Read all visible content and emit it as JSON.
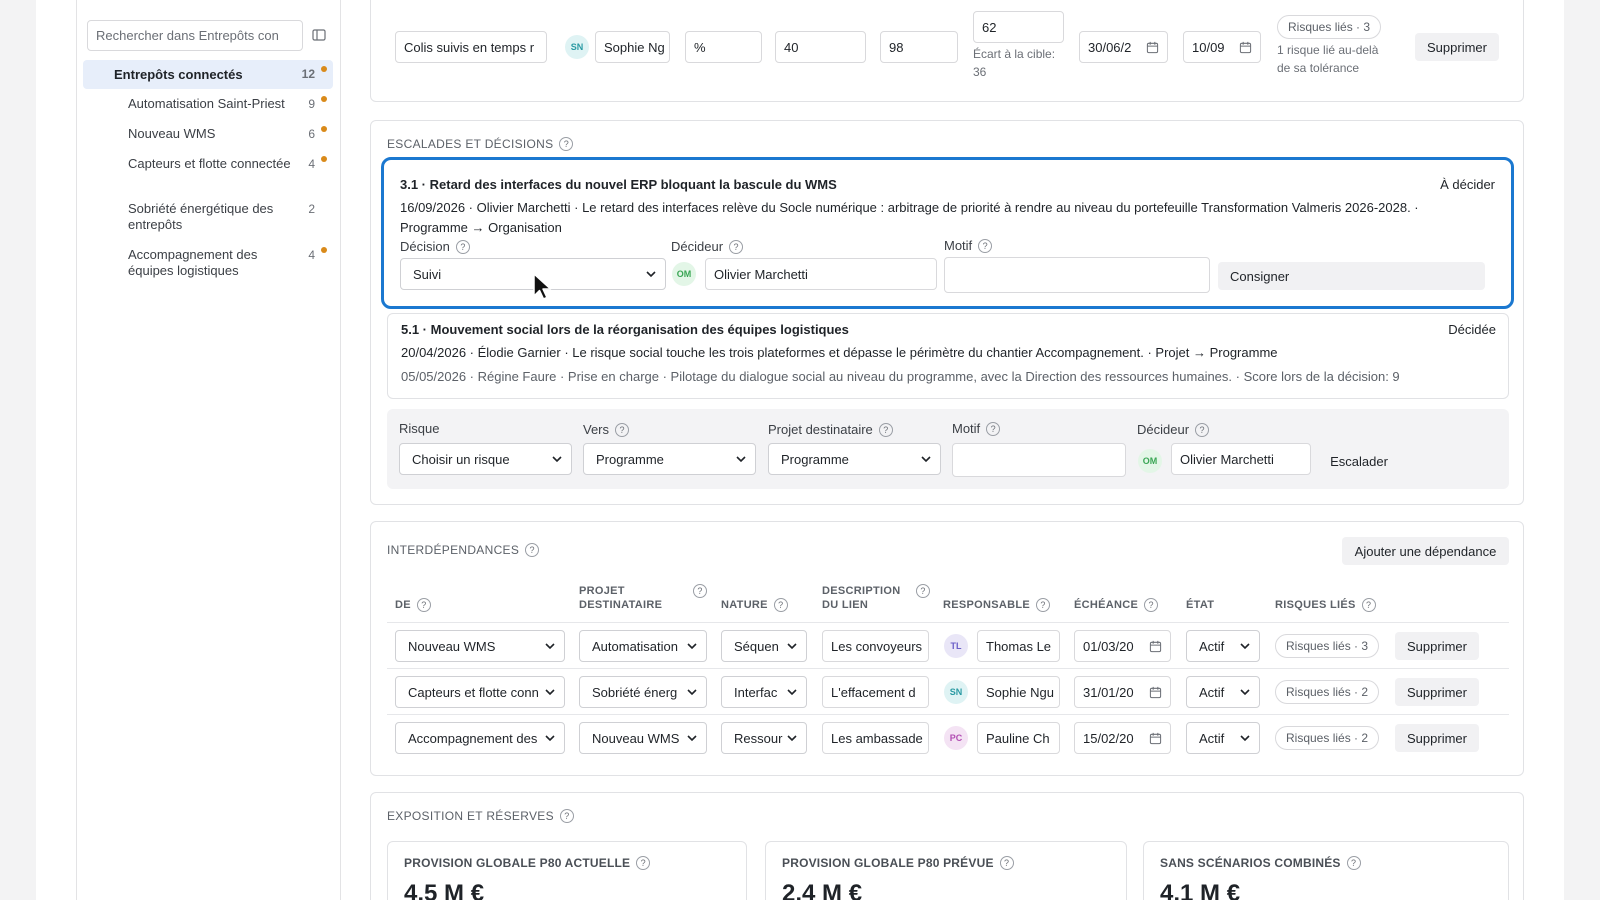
{
  "sidebar": {
    "search_placeholder": "Rechercher dans Entrepôts con",
    "root": {
      "label": "Entrepôts connectés",
      "count": "12"
    },
    "items": [
      {
        "label": "Automatisation Saint-Priest",
        "count": "9",
        "dot": true
      },
      {
        "label": "Nouveau WMS",
        "count": "6",
        "dot": true
      },
      {
        "label": "Capteurs et flotte connectée",
        "count": "4",
        "dot": true
      },
      {
        "label": "Sobriété énergétique des entrepôts",
        "count": "2",
        "dot": false
      },
      {
        "label": "Accompagnement des équipes logistiques",
        "count": "4",
        "dot": true
      }
    ]
  },
  "kpi_row": {
    "name": "Colis suivis en temps r",
    "owner_initials": "SN",
    "owner": "Sophie Ng",
    "unit": "%",
    "baseline": "40",
    "target": "98",
    "current": "62",
    "gap_label": "Écart à la cible:",
    "gap_value": "36",
    "start_date": "30/06/2",
    "end_date": "10/09",
    "risks_pill": "Risques liés · 3",
    "risk_note": "1 risque lié au-delà de sa tolérance",
    "delete_label": "Supprimer"
  },
  "escalations": {
    "title": "ESCALADES ET DÉCISIONS",
    "active": {
      "heading": "3.1 · Retard des interfaces du nouvel ERP bloquant la bascule du WMS",
      "status": "À décider",
      "detail": "16/09/2026 · Olivier Marchetti · Le retard des interfaces relève du Socle numérique : arbitrage de priorité à rendre au niveau du portefeuille Transformation Valmeris 2026-2028. · Programme → Organisation",
      "decision_label": "Décision",
      "decision_value": "Suivi",
      "decider_label": "Décideur",
      "decider_initials": "OM",
      "decider_value": "Olivier Marchetti",
      "motif_label": "Motif",
      "motif_value": "",
      "submit_label": "Consigner"
    },
    "decided": {
      "heading": "5.1 · Mouvement social lors de la réorganisation des équipes logistiques",
      "status": "Décidée",
      "detail": "20/04/2026 · Élodie Garnier · Le risque social touche les trois plateformes et dépasse le périmètre du chantier Accompagnement. · Projet → Programme",
      "outcome": "05/05/2026 · Régine Faure · Prise en charge · Pilotage du dialogue social au niveau du programme, avec la Direction des ressources humaines. · Score lors de la décision: 9"
    },
    "form": {
      "risk_label": "Risque",
      "risk_value": "Choisir un risque",
      "to_label": "Vers",
      "to_value": "Programme",
      "project_label": "Projet destinataire",
      "project_value": "Programme",
      "motif_label": "Motif",
      "motif_value": "",
      "decider_label": "Décideur",
      "decider_initials": "OM",
      "decider_value": "Olivier Marchetti",
      "submit_label": "Escalader"
    }
  },
  "dependencies": {
    "title": "INTERDÉPENDANCES",
    "add_label": "Ajouter une dépendance",
    "headers": {
      "from": "DE",
      "project": "PROJET DESTINATAIRE",
      "nature": "NATURE",
      "desc": "DESCRIPTION DU LIEN",
      "owner": "RESPONSABLE",
      "due": "ÉCHÉANCE",
      "state": "ÉTAT",
      "risks": "RISQUES LIÉS"
    },
    "rows": [
      {
        "from": "Nouveau WMS",
        "project": "Automatisation",
        "nature": "Séquen",
        "desc": "Les convoyeurs",
        "initials": "TL",
        "owner": "Thomas Le",
        "due": "01/03/20",
        "state": "Actif",
        "risks": "Risques liés · 3",
        "delete": "Supprimer"
      },
      {
        "from": "Capteurs et flotte conn",
        "project": "Sobriété énerg",
        "nature": "Interfac",
        "desc": "L'effacement d",
        "initials": "SN",
        "owner": "Sophie Ngu",
        "due": "31/01/20",
        "state": "Actif",
        "risks": "Risques liés · 2",
        "delete": "Supprimer"
      },
      {
        "from": "Accompagnement des",
        "project": "Nouveau WMS",
        "nature": "Ressour",
        "desc": "Les ambassade",
        "initials": "PC",
        "owner": "Pauline Ch",
        "due": "15/02/20",
        "state": "Actif",
        "risks": "Risques liés · 2",
        "delete": "Supprimer"
      }
    ]
  },
  "exposure": {
    "title": "EXPOSITION ET RÉSERVES",
    "metrics": [
      {
        "label": "PROVISION GLOBALE P80 ACTUELLE",
        "value": "4,5 M €"
      },
      {
        "label": "PROVISION GLOBALE P80 PRÉVUE",
        "value": "2,4 M €"
      },
      {
        "label": "SANS SCÉNARIOS COMBINÉS",
        "value": "4,1 M €"
      }
    ]
  },
  "help_glyph": "?"
}
